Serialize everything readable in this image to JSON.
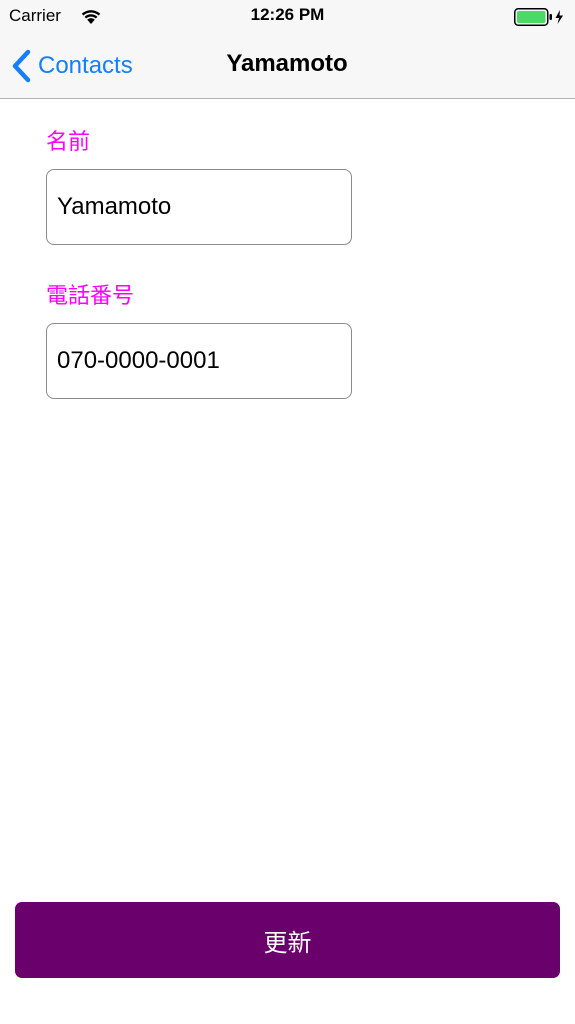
{
  "status_bar": {
    "carrier": "Carrier",
    "time": "12:26 PM",
    "wifi_icon": "wifi-icon",
    "battery_icon": "battery-charging-icon",
    "battery_level": 1.0,
    "battery_color": "#4cd964"
  },
  "nav": {
    "back_label": "Contacts",
    "back_icon": "chevron-left-icon",
    "title": "Yamamoto",
    "tint_color": "#147efb"
  },
  "form": {
    "name_label": "名前",
    "name_value": "Yamamoto",
    "phone_label": "電話番号",
    "phone_value": "070-0000-0001",
    "label_color": "#ff00ff"
  },
  "actions": {
    "update_label": "更新",
    "update_color": "#69006b"
  }
}
